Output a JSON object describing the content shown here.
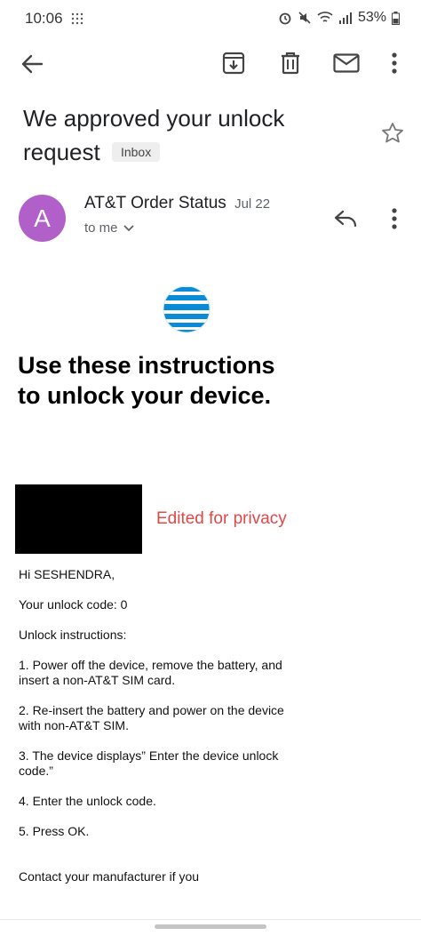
{
  "status_bar": {
    "time": "10:06",
    "battery": "53%"
  },
  "email": {
    "subject": "We approved your unlock request",
    "label": "Inbox",
    "sender": {
      "initial": "A",
      "name": "AT&T Order Status",
      "date": "Jul 22",
      "recipient": "to me",
      "avatar_color": "#b260c9"
    },
    "body": {
      "headline": "Use these instructions to unlock your device.",
      "privacy_note": "Edited for privacy",
      "greeting": "Hi SESHENDRA,",
      "unlock_code": "Your unlock code: 0",
      "instructions_title": "Unlock instructions:",
      "steps": [
        "1. Power off the device, remove the battery, and insert a non-AT&T SIM card.",
        "2. Re-insert the battery and power on the device with non-AT&T SIM.",
        "3. The device displays” Enter the device unlock code.”",
        "4. Enter the unlock code.",
        "5. Press OK."
      ],
      "footer": "Contact your manufacturer if you"
    }
  },
  "colors": {
    "privacy_note": "#e04848",
    "att_blue": "#0a8bd6"
  },
  "icons": [
    "back-arrow-icon",
    "archive-icon",
    "delete-icon",
    "mail-icon",
    "more-vert-icon",
    "star-icon",
    "reply-icon",
    "chevron-down-icon",
    "att-globe-logo"
  ]
}
